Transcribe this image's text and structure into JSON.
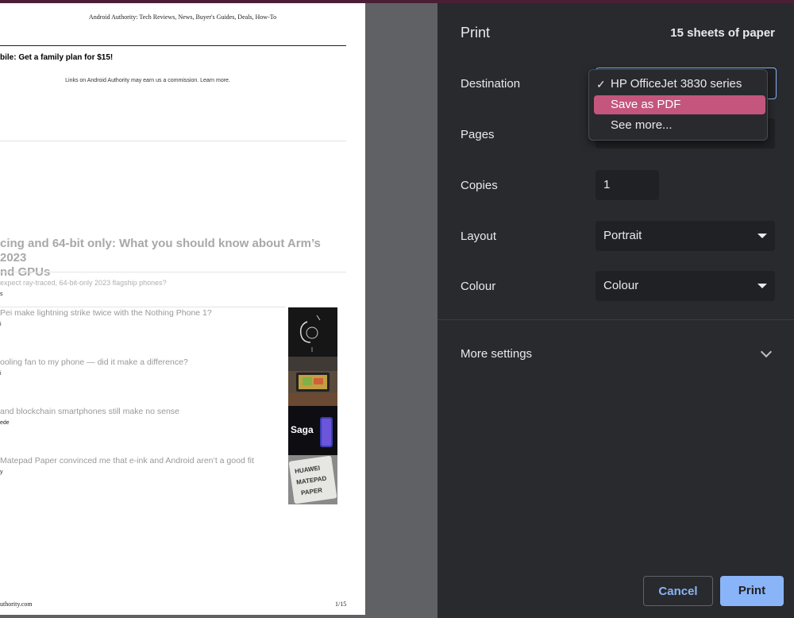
{
  "preview": {
    "header": "Android Authority: Tech Reviews, News, Buyer's Guides, Deals, How-To",
    "promo": "bile: Get a family plan for $15!",
    "disclaimer": "Links on Android Authority may earn us a commission. Learn more.",
    "headline_line1": "cing and 64-bit only: What you should know about Arm’s 2023",
    "headline_line2": "nd GPUs",
    "subline": "expect ray-traced, 64-bit-only 2023 flagship phones?",
    "author0": "s",
    "items": [
      {
        "title": "Pei make lightning strike twice with the Nothing Phone 1?",
        "author": "i"
      },
      {
        "title": "ooling fan to my phone — did it make a difference?",
        "author": "i"
      },
      {
        "title": "and blockchain smartphones still make no sense",
        "author": "ede"
      },
      {
        "title": "Matepad Paper convinced me that e-ink and Android aren’t a good fit",
        "author": "y"
      }
    ],
    "thumb_saga": "Saga",
    "thumb_huawei": "HUAWEI MATEPAD PAPER",
    "footer_left": "uthority.com",
    "footer_right": "1/15"
  },
  "panel": {
    "title": "Print",
    "sheets": "15 sheets of paper",
    "destination_label": "Destination",
    "pages_label": "Pages",
    "copies_label": "Copies",
    "copies_value": "1",
    "layout_label": "Layout",
    "layout_value": "Portrait",
    "colour_label": "Colour",
    "colour_value": "Colour",
    "more_settings": "More settings",
    "cancel": "Cancel",
    "print": "Print"
  },
  "destination_menu": {
    "options": [
      {
        "label": "HP OfficeJet 3830 series",
        "checked": true
      },
      {
        "label": "Save as PDF",
        "highlighted": true
      },
      {
        "label": "See more..."
      }
    ]
  },
  "colors": {
    "panel_bg": "#292a2d",
    "field_bg": "#202124",
    "accent_blue": "#8ab4f8",
    "highlight": "#c4557d"
  }
}
